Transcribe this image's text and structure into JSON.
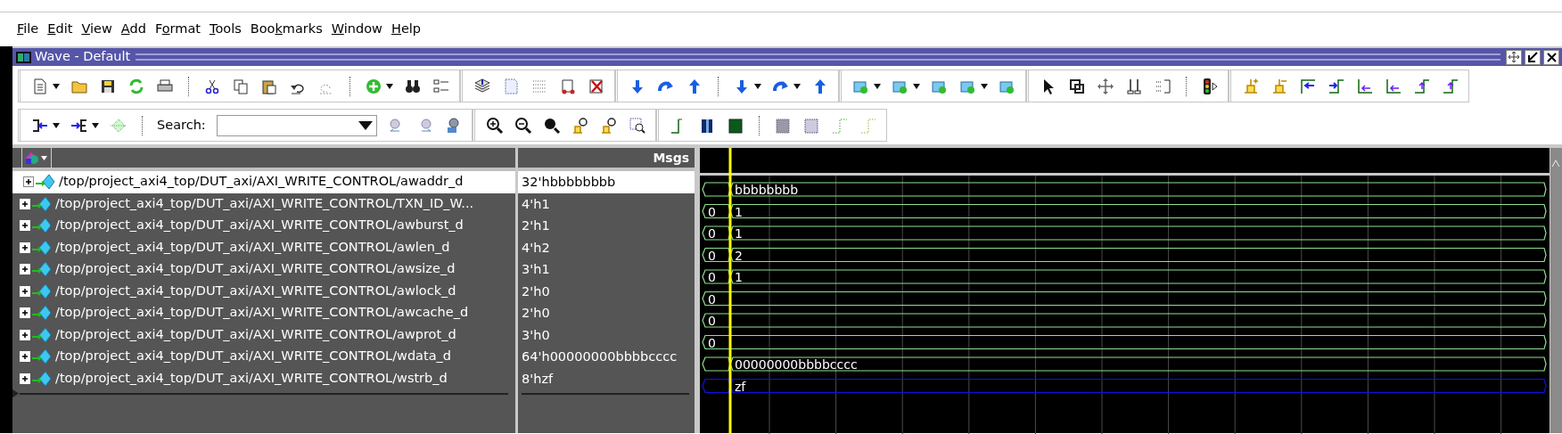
{
  "menu": [
    {
      "key": "F",
      "post": "ile"
    },
    {
      "key": "E",
      "post": "dit"
    },
    {
      "key": "V",
      "post": "iew"
    },
    {
      "key": "A",
      "post": "dd"
    },
    {
      "pre": "F",
      "key": "o",
      "post": "rmat"
    },
    {
      "key": "T",
      "post": "ools"
    },
    {
      "pre": "Boo",
      "key": "k",
      "post": "marks"
    },
    {
      "key": "W",
      "post": "indow"
    },
    {
      "key": "H",
      "post": "elp"
    }
  ],
  "window": {
    "title": "Wave - Default"
  },
  "toolbar": {
    "search_label": "Search:"
  },
  "values_header": "Msgs",
  "signals": [
    {
      "name": "/top/project_axi4_top/DUT_axi/AXI_WRITE_CONTROL/awaddr_d",
      "value": "32'hbbbbbbbb",
      "selected": true,
      "kind": "bus",
      "transition_at_cursor": true,
      "cursor_value": "bbbbbbbb"
    },
    {
      "name": "/top/project_axi4_top/DUT_axi/AXI_WRITE_CONTROL/TXN_ID_W...",
      "value": "4'h1",
      "selected": false,
      "kind": "bus",
      "transition_at_cursor": true,
      "initial_value": "0",
      "cursor_value": "1"
    },
    {
      "name": "/top/project_axi4_top/DUT_axi/AXI_WRITE_CONTROL/awburst_d",
      "value": "2'h1",
      "selected": false,
      "kind": "bus",
      "transition_at_cursor": true,
      "initial_value": "0",
      "cursor_value": "1"
    },
    {
      "name": "/top/project_axi4_top/DUT_axi/AXI_WRITE_CONTROL/awlen_d",
      "value": "4'h2",
      "selected": false,
      "kind": "bus",
      "transition_at_cursor": true,
      "initial_value": "0",
      "cursor_value": "2"
    },
    {
      "name": "/top/project_axi4_top/DUT_axi/AXI_WRITE_CONTROL/awsize_d",
      "value": "3'h1",
      "selected": false,
      "kind": "bus",
      "transition_at_cursor": true,
      "initial_value": "0",
      "cursor_value": "1"
    },
    {
      "name": "/top/project_axi4_top/DUT_axi/AXI_WRITE_CONTROL/awlock_d",
      "value": "2'h0",
      "selected": false,
      "kind": "bus",
      "transition_at_cursor": false,
      "initial_value": "0"
    },
    {
      "name": "/top/project_axi4_top/DUT_axi/AXI_WRITE_CONTROL/awcache_d",
      "value": "2'h0",
      "selected": false,
      "kind": "bus",
      "transition_at_cursor": false,
      "initial_value": "0"
    },
    {
      "name": "/top/project_axi4_top/DUT_axi/AXI_WRITE_CONTROL/awprot_d",
      "value": "3'h0",
      "selected": false,
      "kind": "bus",
      "transition_at_cursor": false,
      "initial_value": "0"
    },
    {
      "name": "/top/project_axi4_top/DUT_axi/AXI_WRITE_CONTROL/wdata_d",
      "value": "64'h00000000bbbbcccc",
      "selected": false,
      "kind": "bus",
      "transition_at_cursor": true,
      "cursor_value": "00000000bbbbcccc"
    },
    {
      "name": "/top/project_axi4_top/DUT_axi/AXI_WRITE_CONTROL/wstrb_d",
      "value": "8'hzf",
      "selected": false,
      "kind": "highz",
      "transition_at_cursor": true,
      "cursor_value": "zf"
    }
  ]
}
